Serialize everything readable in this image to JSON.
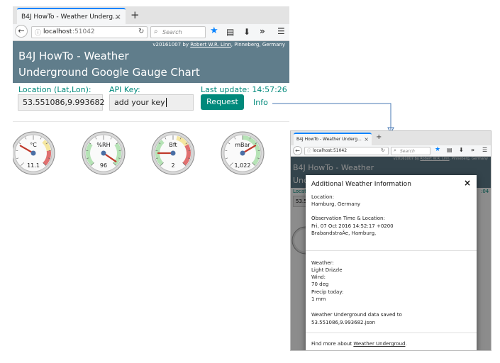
{
  "main_window": {
    "tab_title": "B4J HowTo - Weather Underg...",
    "tab_close": "×",
    "new_tab": "+",
    "url_host": "localhost",
    "url_port": ":51042",
    "search_placeholder": "Search",
    "version_prefix": "v20161007 by ",
    "version_author": "Robert W.R. Linn",
    "version_suffix": ", Pinneberg, Germany",
    "app_title_line1": "B4J HowTo - Weather",
    "app_title_line2": "Underground Google Gauge Chart",
    "location_label": "Location (Lat,Lon):",
    "location_value": "53.551086,9.993682",
    "apikey_label": "API Key:",
    "apikey_value": "add your key",
    "last_update": "Last update: 14:57:26",
    "request_button": "Request",
    "info_link": "Info"
  },
  "gauges": [
    {
      "unit": "°C",
      "value": "11.1",
      "pointer": 11.1,
      "min": 0,
      "max": 40
    },
    {
      "unit": "%RH",
      "value": "96",
      "pointer": 96,
      "min": 0,
      "max": 100
    },
    {
      "unit": "Bft",
      "value": "2",
      "pointer": 2,
      "min": 0,
      "max": 12
    },
    {
      "unit": "mBar",
      "value": "1,022",
      "pointer": 1022,
      "min": 950,
      "max": 1050
    }
  ],
  "small_window": {
    "tab_title": "B4J HowTo - Weather Underg...",
    "tab_close": "×",
    "new_tab": "+",
    "url_text": "localhost:51042",
    "search_placeholder": "Search",
    "version_prefix": "v20161007 by ",
    "version_author": "Robert W.R. Linn",
    "version_suffix": ", Pinneberg, Germany",
    "bg_title_line1": "B4J HowTo - Weather",
    "bg_title_line2": "Und",
    "bg_location": "Locati",
    "bg_update": ":04",
    "bg_input": "53.5"
  },
  "modal": {
    "title": "Additional Weather Information",
    "close": "×",
    "location_label": "Location:",
    "location_value": "Hamburg, Germany",
    "obs_label": "Observation Time & Location:",
    "obs_time": "Fri, 07 Oct 2016 14:52:17 +0200",
    "obs_place": "BrabandstraÃe, Hamburg,",
    "weather_label": "Weather:",
    "weather_value": "Light Drizzle",
    "wind_label": "Wind:",
    "wind_value": "70 deg",
    "precip_label": "Precip today:",
    "precip_value": "1 mm",
    "saved_line1": "Weather Underground data saved to",
    "saved_line2": "53.551086,9.993682.json",
    "more_prefix": "Find more about ",
    "more_link": "Weather Undergroud",
    "more_suffix": "."
  },
  "colors": {
    "header_bg": "#607d8b",
    "accent": "#00897b",
    "browser_highlight": "#0a84ff",
    "gauge_green": "#b6e3b6",
    "gauge_yellow": "#f5e6a0",
    "gauge_red": "#e07070"
  },
  "icons": [
    "back-arrow-icon",
    "info-icon",
    "reload-icon",
    "search-icon",
    "bookmark-star-icon",
    "library-icon",
    "download-icon",
    "overflow-icon",
    "menu-icon"
  ]
}
